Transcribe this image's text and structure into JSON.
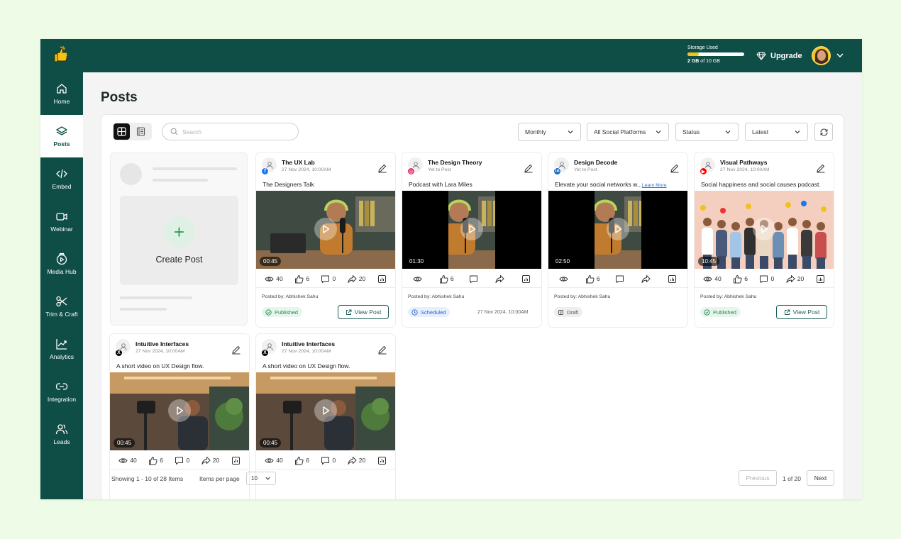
{
  "topbar": {
    "storage_label": "Storage Used",
    "storage_used": "2 GB",
    "storage_of": "of 10 GB",
    "storage_fraction": 0.2,
    "upgrade_label": "Upgrade"
  },
  "sidebar": {
    "items": [
      {
        "label": "Home",
        "icon": "home-icon"
      },
      {
        "label": "Posts",
        "icon": "layers-icon",
        "active": true
      },
      {
        "label": "Embed",
        "icon": "code-icon"
      },
      {
        "label": "Webinar",
        "icon": "video-camera-icon"
      },
      {
        "label": "Media Hub",
        "icon": "media-hub-icon"
      },
      {
        "label": "Trim & Craft",
        "icon": "scissors-icon"
      },
      {
        "label": "Analytics",
        "icon": "trend-chart-icon"
      },
      {
        "label": "Integration",
        "icon": "link-icon"
      },
      {
        "label": "Leads",
        "icon": "users-icon"
      }
    ]
  },
  "page": {
    "title": "Posts"
  },
  "toolbar": {
    "search_placeholder": "Search",
    "period": "Monthly",
    "platform": "All Social Platforms",
    "status": "Status",
    "sort": "Latest"
  },
  "create": {
    "label": "Create Post"
  },
  "posts": [
    {
      "name": "The UX Lab",
      "date": "27 Nov 2024, 10:00AM",
      "platform": "facebook",
      "platform_color": "#1877f2",
      "caption": "The Designers Talk",
      "more": "",
      "duration": "00:45",
      "views": "40",
      "likes": "6",
      "comments": "0",
      "shares": "20",
      "posted_by_label": "Posted by:",
      "posted_by": "Abhishek Sahu",
      "status": "Published",
      "action": "View Post",
      "scene": "podcast"
    },
    {
      "name": "The Design Theory",
      "date": "Yet to Post",
      "platform": "instagram",
      "platform_color": "#e1306c",
      "caption": "Podcast with Lara Miles",
      "more": "",
      "duration": "01:30",
      "views": "",
      "likes": "6",
      "comments": "",
      "shares": "",
      "posted_by_label": "Posted by:",
      "posted_by": "Abhishek Sahu",
      "status": "Scheduled",
      "scheduled_date": "27 Nov 2024, 10:00AM",
      "scene": "podcast-narrow"
    },
    {
      "name": "Design Decode",
      "date": "Yet to Post",
      "platform": "linkedin",
      "platform_color": "#0a66c2",
      "caption": "Elevate your social networks w...",
      "more": "Learn More",
      "duration": "02:50",
      "views": "",
      "likes": "6",
      "comments": "",
      "shares": "",
      "posted_by_label": "Posted by:",
      "posted_by": "Abhishek Sahu",
      "status": "Draft",
      "scene": "podcast-narrow"
    },
    {
      "name": "Visual Pathways",
      "date": "27 Nov 2024, 10:00AM",
      "platform": "youtube",
      "platform_color": "#ff0000",
      "caption": "Social happiness and social causes podcast.",
      "more": "",
      "duration": "10:45",
      "views": "40",
      "likes": "6",
      "comments": "0",
      "shares": "20",
      "posted_by_label": "Posted by:",
      "posted_by": "Abhishek Sahu",
      "status": "Published",
      "action": "View Post",
      "scene": "crowd"
    },
    {
      "name": "Intuitive Interfaces",
      "date": "27 Nov 2024, 10:00AM",
      "platform": "x",
      "platform_color": "#000000",
      "caption": "A short video on UX Design flow.",
      "more": "",
      "duration": "00:45",
      "views": "40",
      "likes": "6",
      "comments": "0",
      "shares": "20",
      "scene": "studio"
    },
    {
      "name": "Intuitive Interfaces",
      "date": "27 Nov 2024, 10:00AM",
      "platform": "x",
      "platform_color": "#000000",
      "caption": "A short video on UX Design flow.",
      "more": "",
      "duration": "00:45",
      "views": "40",
      "likes": "6",
      "comments": "0",
      "shares": "20",
      "scene": "studio"
    }
  ],
  "footer": {
    "showing": "Showing 1 - 10 of 28 Items",
    "items_per_page_label": "Items per page",
    "items_per_page": "10",
    "previous": "Previous",
    "page_info": "1 of 20",
    "next": "Next"
  },
  "colors": {
    "brand": "#0f4d47",
    "accent": "#f1c21b",
    "published": "#1e8a4a",
    "scheduled": "#2a64c8"
  }
}
